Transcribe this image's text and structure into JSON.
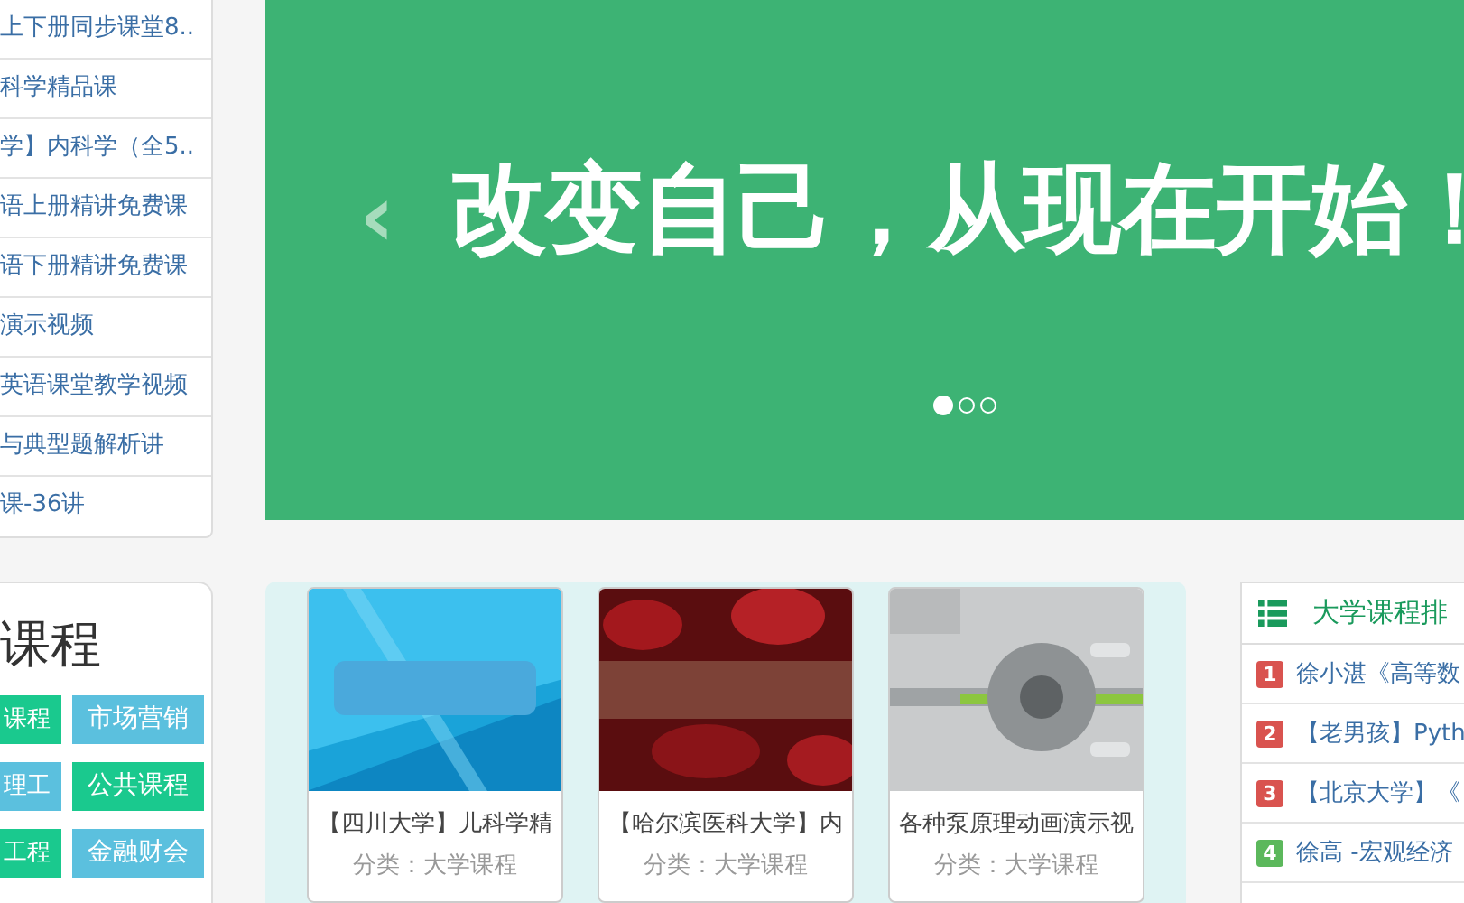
{
  "course_list": {
    "items": [
      "上下册同步课堂8..",
      "科学精品课",
      "学】内科学（全5..",
      "语上册精讲免费课",
      "语下册精讲免费课",
      "演示视频",
      "英语课堂教学视频",
      "与典型题解析讲",
      "课-36讲"
    ]
  },
  "banner": {
    "slide_title": "改变自己，从现在开始！",
    "prev_arrow": "‹",
    "dots": [
      {
        "selected": true
      },
      {
        "selected": false
      },
      {
        "selected": false
      }
    ]
  },
  "categories": {
    "title": "课程",
    "tags": [
      {
        "label": "课程",
        "color": "#1ac98e"
      },
      {
        "label": "市场营销",
        "color": "#5bc0de"
      },
      {
        "label": "理工",
        "color": "#5bc0de"
      },
      {
        "label": "公共课程",
        "color": "#1ac98e"
      },
      {
        "label": "工程",
        "color": "#1ac98e"
      },
      {
        "label": "金融财会",
        "color": "#5bc0de"
      }
    ]
  },
  "courses": [
    {
      "kind": "picture",
      "title": "【四川大学】儿科学精",
      "category": "分类：大学课程"
    },
    {
      "kind": "picture",
      "title": "【哈尔滨医科大学】内",
      "category": "分类：大学课程"
    },
    {
      "kind": "picture",
      "title": "各种泵原理动画演示视",
      "category": "分类：大学课程"
    }
  ],
  "ranking": {
    "title": "大学课程排",
    "rows": [
      {
        "rank": "1",
        "color": "#d9534f",
        "title": "徐小湛《高等数"
      },
      {
        "rank": "2",
        "color": "#d9534f",
        "title": "【老男孩】Pyth"
      },
      {
        "rank": "3",
        "color": "#d9534f",
        "title": "【北京大学】《"
      },
      {
        "rank": "4",
        "color": "#5cb85c",
        "title": "徐高 -宏观经济"
      }
    ]
  }
}
